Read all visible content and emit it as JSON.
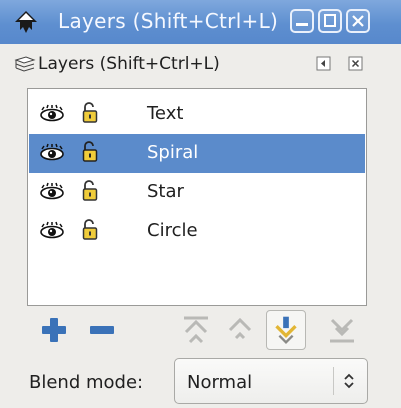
{
  "window": {
    "title": "Layers (Shift+Ctrl+L)"
  },
  "dock": {
    "title": "Layers (Shift+Ctrl+L)"
  },
  "layers": [
    {
      "name": "Text",
      "visible": true,
      "locked": false,
      "selected": false
    },
    {
      "name": "Spiral",
      "visible": true,
      "locked": false,
      "selected": true
    },
    {
      "name": "Star",
      "visible": true,
      "locked": false,
      "selected": false
    },
    {
      "name": "Circle",
      "visible": true,
      "locked": false,
      "selected": false
    }
  ],
  "blend": {
    "label": "Blend mode:",
    "value": "Normal"
  },
  "colors": {
    "titlebar": "#5e8fd0",
    "selection": "#5b8bcb",
    "accent": "#3a72b8"
  }
}
